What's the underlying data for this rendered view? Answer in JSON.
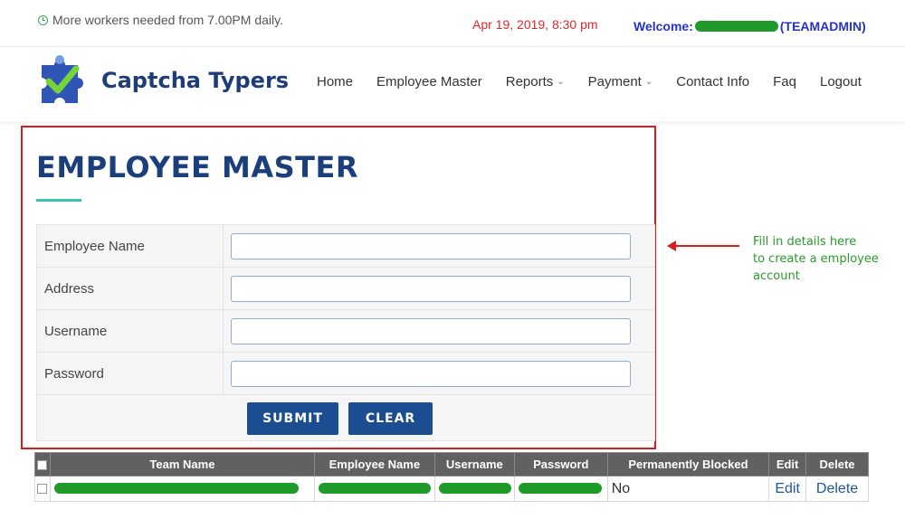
{
  "topbar": {
    "notice": "More workers needed from 7.00PM daily.",
    "datetime": "Apr 19, 2019, 8:30 pm",
    "welcome_prefix": "Welcome:",
    "welcome_role": "(TEAMADMIN)"
  },
  "brand": {
    "name": "Captcha Typers"
  },
  "nav": {
    "home": "Home",
    "employee_master": "Employee Master",
    "reports": "Reports",
    "payment": "Payment",
    "contact": "Contact Info",
    "faq": "Faq",
    "logout": "Logout"
  },
  "page": {
    "title": "EMPLOYEE MASTER"
  },
  "form": {
    "fields": [
      {
        "label": "Employee Name",
        "value": ""
      },
      {
        "label": "Address",
        "value": ""
      },
      {
        "label": "Username",
        "value": ""
      },
      {
        "label": "Password",
        "value": ""
      }
    ],
    "submit": "SUBMIT",
    "clear": "CLEAR"
  },
  "annotation": {
    "line1": "Fill in details here",
    "line2": "to create a employee",
    "line3": "account"
  },
  "table": {
    "headers": [
      "Team Name",
      "Employee Name",
      "Username",
      "Password",
      "Permanently Blocked",
      "Edit",
      "Delete"
    ],
    "rows": [
      {
        "blocked": "No",
        "edit": "Edit",
        "delete": "Delete"
      }
    ]
  },
  "colors": {
    "accent": "#1b4d90",
    "title": "#1b3f7c",
    "highlight_border": "#d81d1d",
    "annotation": "#2a9a2e",
    "redaction": "#1f9a2b"
  }
}
